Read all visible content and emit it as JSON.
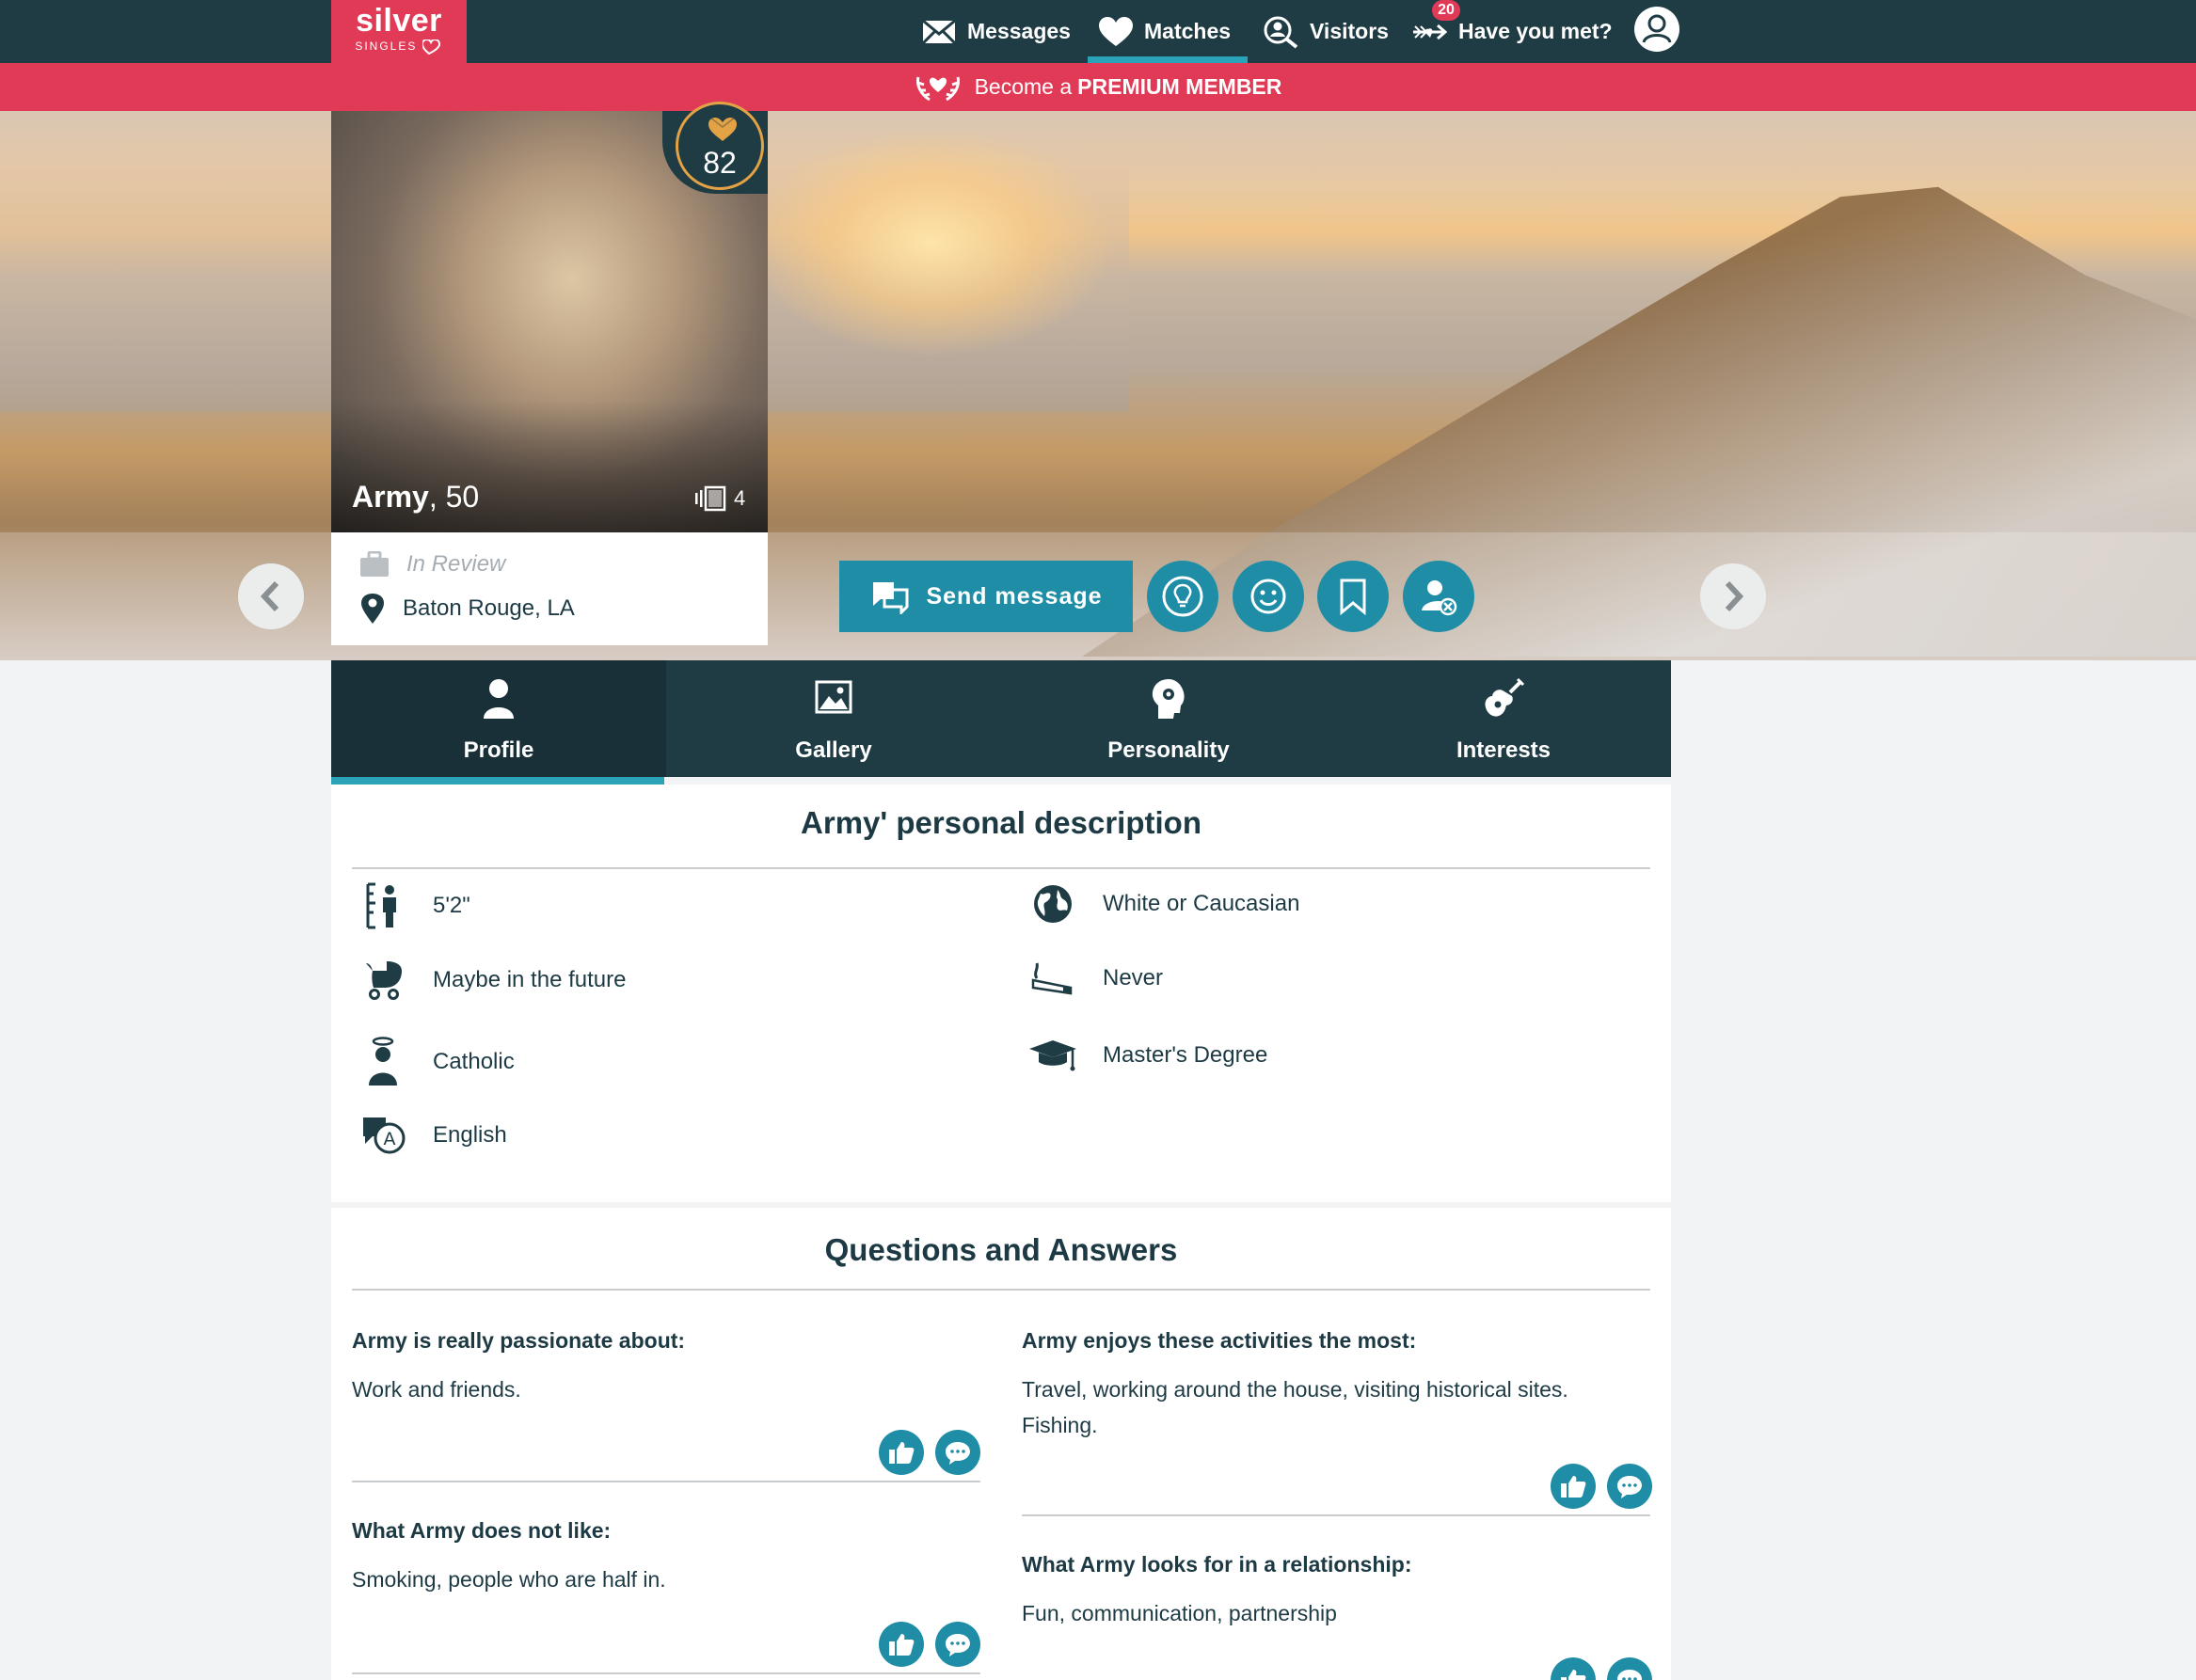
{
  "logo": {
    "line1": "silver",
    "line2": "SINGLES"
  },
  "nav": {
    "messages": "Messages",
    "matches": "Matches",
    "visitors": "Visitors",
    "have_you_met": "Have you met?",
    "have_you_met_badge": "20"
  },
  "premium": {
    "prefix": "Become a",
    "emphasis": "PREMIUM MEMBER"
  },
  "profile": {
    "name": "Army",
    "age": ", 50",
    "photo_count": "4",
    "match_score": "82",
    "job": "In Review",
    "location": "Baton Rouge, LA"
  },
  "actions": {
    "send_message": "Send message"
  },
  "tabs": [
    {
      "label": "Profile"
    },
    {
      "label": "Gallery"
    },
    {
      "label": "Personality"
    },
    {
      "label": "Interests"
    }
  ],
  "description": {
    "title": "Army' personal description",
    "height": "5'2\"",
    "children": "Maybe in the future",
    "religion": "Catholic",
    "language": "English",
    "ethnicity": "White or Caucasian",
    "smoking": "Never",
    "education": "Master's Degree"
  },
  "qa": {
    "title": "Questions and Answers",
    "items": [
      {
        "question": "Army is really passionate about:",
        "answer": "Work and friends."
      },
      {
        "question": "Army enjoys these activities the most:",
        "answer": "Travel, working around the house, visiting historical sites. Fishing."
      },
      {
        "question": "What Army does not like:",
        "answer": "Smoking, people who are half in."
      },
      {
        "question": "What Army looks for in a relationship:",
        "answer": "Fun, communication, partnership"
      }
    ]
  },
  "colors": {
    "navy": "#1f3c45",
    "brand_red": "#e03a56",
    "teal": "#1f8da6",
    "accent_gold": "#e3a244"
  }
}
